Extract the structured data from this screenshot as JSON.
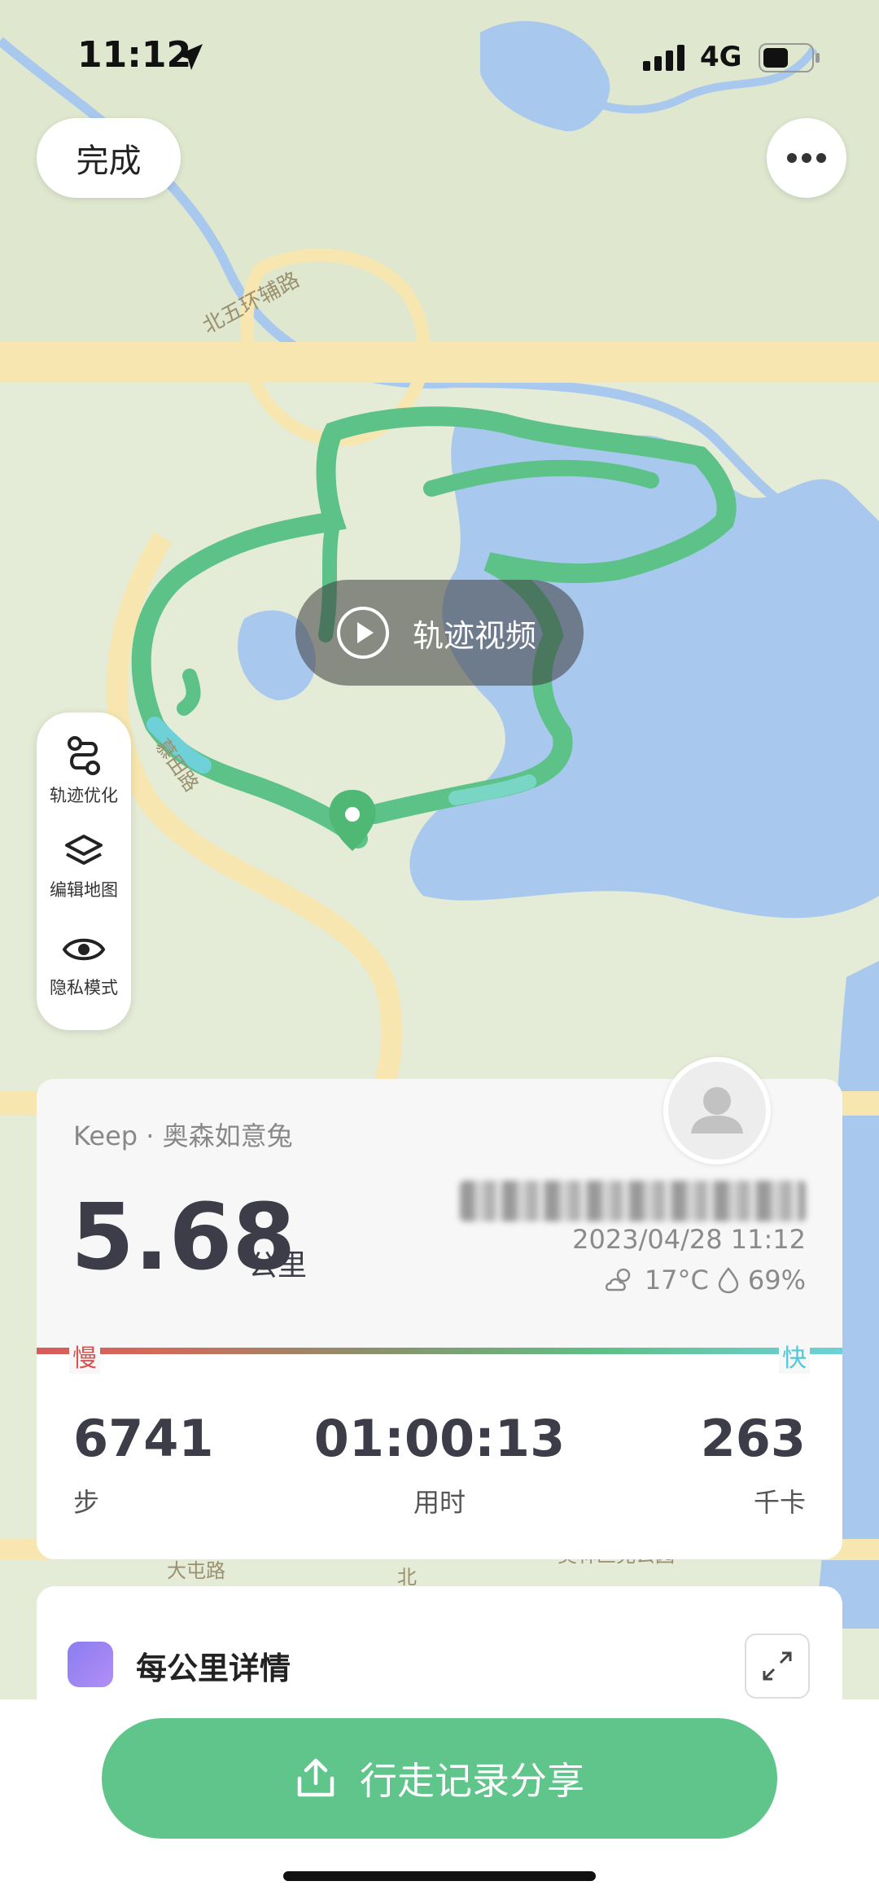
{
  "status_bar": {
    "time": "11:12",
    "network": "4G"
  },
  "header": {
    "done_label": "完成"
  },
  "map": {
    "road_labels": [
      "北五环辅路",
      "大屯路",
      "北",
      "奥林匹克公园"
    ],
    "road_label_side": "慕田路"
  },
  "video_button": {
    "label": "轨迹视频"
  },
  "tools": [
    {
      "label": "轨迹优化",
      "icon": "route-icon"
    },
    {
      "label": "编辑地图",
      "icon": "layers-icon"
    },
    {
      "label": "隐私模式",
      "icon": "eye-icon"
    }
  ],
  "summary": {
    "author": "Keep · 奥森如意兔",
    "distance": "5.68",
    "distance_unit": "公里",
    "datetime": "2023/04/28 11:12",
    "temperature": "17°C",
    "humidity": "69%",
    "slow_label": "慢",
    "fast_label": "快",
    "stats": [
      {
        "value": "6741",
        "label": "步"
      },
      {
        "value": "01:00:13",
        "label": "用时"
      },
      {
        "value": "263",
        "label": "千卡"
      }
    ]
  },
  "details": {
    "title": "每公里详情"
  },
  "share": {
    "label": "行走记录分享"
  },
  "colors": {
    "accent": "#5fc58a",
    "slow": "#d9534f",
    "fast": "#4fc9d8",
    "track": "#5cc287"
  }
}
